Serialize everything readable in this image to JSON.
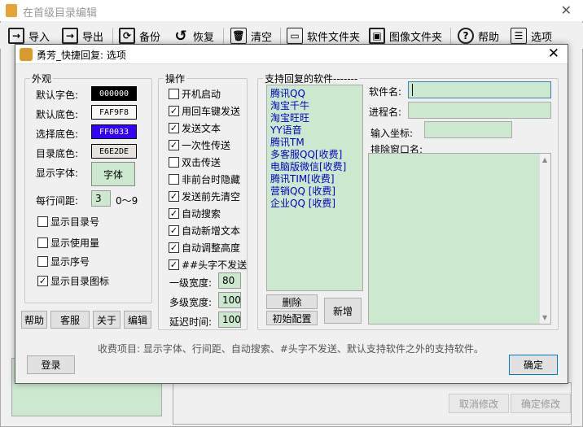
{
  "bg_window": {
    "title": "在首级目录编辑",
    "toolbar": [
      {
        "label": "导入",
        "icon": "import-icon"
      },
      {
        "label": "导出",
        "icon": "export-icon"
      },
      {
        "label": "备份",
        "icon": "backup-icon"
      },
      {
        "label": "恢复",
        "icon": "restore-icon"
      },
      {
        "label": "清空",
        "icon": "trash-icon"
      },
      {
        "label": "软件文件夹",
        "icon": "folder-icon"
      },
      {
        "label": "图像文件夹",
        "icon": "image-icon"
      },
      {
        "label": "帮助",
        "icon": "help-icon"
      },
      {
        "label": "选项",
        "icon": "options-icon"
      }
    ],
    "cancel_label": "取消修改",
    "confirm_label": "确定修改"
  },
  "dialog": {
    "title": "勇芳_快捷回复: 选项",
    "appearance": {
      "legend": "外观",
      "rows": [
        {
          "label": "默认字色:",
          "value": "000000",
          "bg": "#000000",
          "fg": "#ffffff"
        },
        {
          "label": "默认底色:",
          "value": "FAF9F8",
          "bg": "#FAF9F8",
          "fg": "#000000"
        },
        {
          "label": "选择底色:",
          "value": "FF0033",
          "bg": "#3300FF",
          "fg": "#ffffff"
        },
        {
          "label": "目录底色:",
          "value": "E6E2DE",
          "bg": "#E6E2DE",
          "fg": "#000000"
        }
      ],
      "font_label": "显示字体:",
      "font_button": "字体",
      "spacing_label": "每行间距:",
      "spacing_value": "3",
      "spacing_range": "0～9",
      "checks": [
        {
          "label": "显示目录号",
          "checked": false
        },
        {
          "label": "显示使用量",
          "checked": false
        },
        {
          "label": "显示序号",
          "checked": false
        },
        {
          "label": "显示目录图标",
          "checked": true
        }
      ],
      "buttons": [
        "帮助",
        "客服",
        "关于",
        "编辑"
      ]
    },
    "operations": {
      "legend": "操作",
      "checks": [
        {
          "label": "开机启动",
          "checked": false
        },
        {
          "label": "用回车键发送",
          "checked": true
        },
        {
          "label": "发送文本",
          "checked": true
        },
        {
          "label": "一次性传送",
          "checked": true
        },
        {
          "label": "双击传送",
          "checked": false
        },
        {
          "label": "非前台时隐藏",
          "checked": false
        },
        {
          "label": "发送前先清空",
          "checked": true
        },
        {
          "label": "自动搜索",
          "checked": true
        },
        {
          "label": "自动新增文本",
          "checked": true
        },
        {
          "label": "自动调整高度",
          "checked": true
        },
        {
          "label": "##头字不发送",
          "checked": true
        }
      ],
      "fields": [
        {
          "label": "一级宽度:",
          "value": "80"
        },
        {
          "label": "多级宽度:",
          "value": "100"
        },
        {
          "label": "延迟时间:",
          "value": "100"
        }
      ]
    },
    "software": {
      "legend": "支持回复的软件-------",
      "list": [
        "腾讯QQ",
        "淘宝千牛",
        "淘宝旺旺",
        "YY语音",
        "腾讯TM",
        "多客服QQ[收费]",
        "电脑版微信[收费]",
        "腾讯TIM[收费]",
        "营销QQ [收费]",
        "企业QQ [收费]"
      ],
      "delete_label": "删除",
      "init_label": "初始配置",
      "add_label": "新增",
      "name_label": "软件名:",
      "process_label": "进程名:",
      "coord_label": "输入坐标:",
      "exclude_label": "排除窗口名:",
      "name_value": "",
      "process_value": "",
      "coord_value": ""
    },
    "note": "收费项目: 显示字体、行间距、自动搜索、#头字不发送、默认支持软件之外的支持软件。",
    "login_label": "登录",
    "ok_label": "确定"
  }
}
